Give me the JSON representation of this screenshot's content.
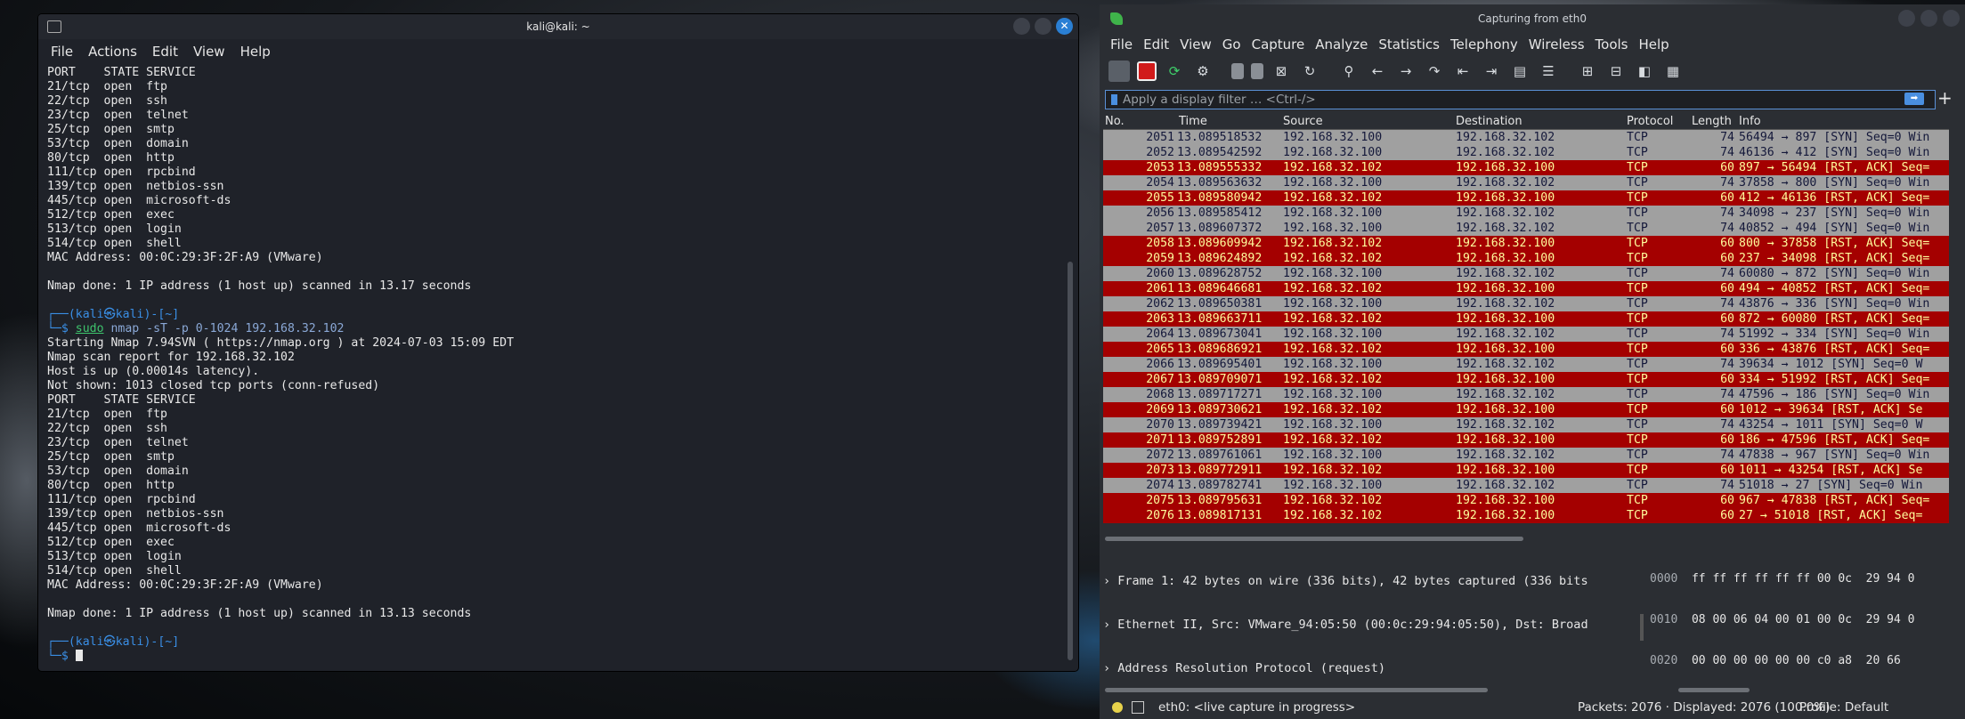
{
  "terminal": {
    "title": "kali@kali: ~",
    "menu": [
      "File",
      "Actions",
      "Edit",
      "View",
      "Help"
    ],
    "lines": [
      {
        "t": "plain",
        "text": "PORT    STATE SERVICE"
      },
      {
        "t": "plain",
        "text": "21/tcp  open  ftp"
      },
      {
        "t": "plain",
        "text": "22/tcp  open  ssh"
      },
      {
        "t": "plain",
        "text": "23/tcp  open  telnet"
      },
      {
        "t": "plain",
        "text": "25/tcp  open  smtp"
      },
      {
        "t": "plain",
        "text": "53/tcp  open  domain"
      },
      {
        "t": "plain",
        "text": "80/tcp  open  http"
      },
      {
        "t": "plain",
        "text": "111/tcp open  rpcbind"
      },
      {
        "t": "plain",
        "text": "139/tcp open  netbios-ssn"
      },
      {
        "t": "plain",
        "text": "445/tcp open  microsoft-ds"
      },
      {
        "t": "plain",
        "text": "512/tcp open  exec"
      },
      {
        "t": "plain",
        "text": "513/tcp open  login"
      },
      {
        "t": "plain",
        "text": "514/tcp open  shell"
      },
      {
        "t": "plain",
        "text": "MAC Address: 00:0C:29:3F:2F:A9 (VMware)"
      },
      {
        "t": "plain",
        "text": ""
      },
      {
        "t": "plain",
        "text": "Nmap done: 1 IP address (1 host up) scanned in 13.17 seconds"
      },
      {
        "t": "plain",
        "text": ""
      },
      {
        "t": "prompt1",
        "text": "┌──(kali㉿kali)-[~]"
      },
      {
        "t": "cmd",
        "prefix": "└─$ ",
        "cmd": "sudo",
        "args": " nmap -sT -p 0-1024 192.168.32.102"
      },
      {
        "t": "plain",
        "text": "Starting Nmap 7.94SVN ( https://nmap.org ) at 2024-07-03 15:09 EDT"
      },
      {
        "t": "plain",
        "text": "Nmap scan report for 192.168.32.102"
      },
      {
        "t": "plain",
        "text": "Host is up (0.00014s latency)."
      },
      {
        "t": "plain",
        "text": "Not shown: 1013 closed tcp ports (conn-refused)"
      },
      {
        "t": "plain",
        "text": "PORT    STATE SERVICE"
      },
      {
        "t": "plain",
        "text": "21/tcp  open  ftp"
      },
      {
        "t": "plain",
        "text": "22/tcp  open  ssh"
      },
      {
        "t": "plain",
        "text": "23/tcp  open  telnet"
      },
      {
        "t": "plain",
        "text": "25/tcp  open  smtp"
      },
      {
        "t": "plain",
        "text": "53/tcp  open  domain"
      },
      {
        "t": "plain",
        "text": "80/tcp  open  http"
      },
      {
        "t": "plain",
        "text": "111/tcp open  rpcbind"
      },
      {
        "t": "plain",
        "text": "139/tcp open  netbios-ssn"
      },
      {
        "t": "plain",
        "text": "445/tcp open  microsoft-ds"
      },
      {
        "t": "plain",
        "text": "512/tcp open  exec"
      },
      {
        "t": "plain",
        "text": "513/tcp open  login"
      },
      {
        "t": "plain",
        "text": "514/tcp open  shell"
      },
      {
        "t": "plain",
        "text": "MAC Address: 00:0C:29:3F:2F:A9 (VMware)"
      },
      {
        "t": "plain",
        "text": ""
      },
      {
        "t": "plain",
        "text": "Nmap done: 1 IP address (1 host up) scanned in 13.13 seconds"
      },
      {
        "t": "plain",
        "text": ""
      },
      {
        "t": "prompt1",
        "text": "┌──(kali㉿kali)-[~]"
      },
      {
        "t": "cursor",
        "prefix": "└─$ "
      }
    ]
  },
  "wireshark": {
    "title": "Capturing from eth0",
    "menu": [
      "File",
      "Edit",
      "View",
      "Go",
      "Capture",
      "Analyze",
      "Statistics",
      "Telephony",
      "Wireless",
      "Tools",
      "Help"
    ],
    "filter_placeholder": "Apply a display filter … <Ctrl-/>",
    "columns": {
      "no": "No.",
      "time": "Time",
      "source": "Source",
      "destination": "Destination",
      "protocol": "Protocol",
      "length": "Length",
      "info": "Info"
    },
    "packets": [
      {
        "no": "2051",
        "time": "13.089518532",
        "src": "192.168.32.100",
        "dst": "192.168.32.102",
        "proto": "TCP",
        "len": "74",
        "info": "56494 → 897 [SYN] Seq=0 Win",
        "kind": "syn"
      },
      {
        "no": "2052",
        "time": "13.089542592",
        "src": "192.168.32.100",
        "dst": "192.168.32.102",
        "proto": "TCP",
        "len": "74",
        "info": "46136 → 412 [SYN] Seq=0 Win",
        "kind": "syn"
      },
      {
        "no": "2053",
        "time": "13.089555332",
        "src": "192.168.32.102",
        "dst": "192.168.32.100",
        "proto": "TCP",
        "len": "60",
        "info": "897 → 56494 [RST, ACK] Seq=",
        "kind": "rst"
      },
      {
        "no": "2054",
        "time": "13.089563632",
        "src": "192.168.32.100",
        "dst": "192.168.32.102",
        "proto": "TCP",
        "len": "74",
        "info": "37858 → 800 [SYN] Seq=0 Win",
        "kind": "syn"
      },
      {
        "no": "2055",
        "time": "13.089580942",
        "src": "192.168.32.102",
        "dst": "192.168.32.100",
        "proto": "TCP",
        "len": "60",
        "info": "412 → 46136 [RST, ACK] Seq=",
        "kind": "rst"
      },
      {
        "no": "2056",
        "time": "13.089585412",
        "src": "192.168.32.100",
        "dst": "192.168.32.102",
        "proto": "TCP",
        "len": "74",
        "info": "34098 → 237 [SYN] Seq=0 Win",
        "kind": "syn"
      },
      {
        "no": "2057",
        "time": "13.089607372",
        "src": "192.168.32.100",
        "dst": "192.168.32.102",
        "proto": "TCP",
        "len": "74",
        "info": "40852 → 494 [SYN] Seq=0 Win",
        "kind": "syn"
      },
      {
        "no": "2058",
        "time": "13.089609942",
        "src": "192.168.32.102",
        "dst": "192.168.32.100",
        "proto": "TCP",
        "len": "60",
        "info": "800 → 37858 [RST, ACK] Seq=",
        "kind": "rst"
      },
      {
        "no": "2059",
        "time": "13.089624892",
        "src": "192.168.32.102",
        "dst": "192.168.32.100",
        "proto": "TCP",
        "len": "60",
        "info": "237 → 34098 [RST, ACK] Seq=",
        "kind": "rst"
      },
      {
        "no": "2060",
        "time": "13.089628752",
        "src": "192.168.32.100",
        "dst": "192.168.32.102",
        "proto": "TCP",
        "len": "74",
        "info": "60080 → 872 [SYN] Seq=0 Win",
        "kind": "syn"
      },
      {
        "no": "2061",
        "time": "13.089646681",
        "src": "192.168.32.102",
        "dst": "192.168.32.100",
        "proto": "TCP",
        "len": "60",
        "info": "494 → 40852 [RST, ACK] Seq=",
        "kind": "rst"
      },
      {
        "no": "2062",
        "time": "13.089650381",
        "src": "192.168.32.100",
        "dst": "192.168.32.102",
        "proto": "TCP",
        "len": "74",
        "info": "43876 → 336 [SYN] Seq=0 Win",
        "kind": "syn"
      },
      {
        "no": "2063",
        "time": "13.089663711",
        "src": "192.168.32.102",
        "dst": "192.168.32.100",
        "proto": "TCP",
        "len": "60",
        "info": "872 → 60080 [RST, ACK] Seq=",
        "kind": "rst"
      },
      {
        "no": "2064",
        "time": "13.089673041",
        "src": "192.168.32.100",
        "dst": "192.168.32.102",
        "proto": "TCP",
        "len": "74",
        "info": "51992 → 334 [SYN] Seq=0 Win",
        "kind": "syn"
      },
      {
        "no": "2065",
        "time": "13.089686921",
        "src": "192.168.32.102",
        "dst": "192.168.32.100",
        "proto": "TCP",
        "len": "60",
        "info": "336 → 43876 [RST, ACK] Seq=",
        "kind": "rst"
      },
      {
        "no": "2066",
        "time": "13.089695401",
        "src": "192.168.32.100",
        "dst": "192.168.32.102",
        "proto": "TCP",
        "len": "74",
        "info": "39634 → 1012 [SYN] Seq=0 W",
        "kind": "syn"
      },
      {
        "no": "2067",
        "time": "13.089709071",
        "src": "192.168.32.102",
        "dst": "192.168.32.100",
        "proto": "TCP",
        "len": "60",
        "info": "334 → 51992 [RST, ACK] Seq=",
        "kind": "rst"
      },
      {
        "no": "2068",
        "time": "13.089717271",
        "src": "192.168.32.100",
        "dst": "192.168.32.102",
        "proto": "TCP",
        "len": "74",
        "info": "47596 → 186 [SYN] Seq=0 Win",
        "kind": "syn"
      },
      {
        "no": "2069",
        "time": "13.089730621",
        "src": "192.168.32.102",
        "dst": "192.168.32.100",
        "proto": "TCP",
        "len": "60",
        "info": "1012 → 39634 [RST, ACK] Se",
        "kind": "rst"
      },
      {
        "no": "2070",
        "time": "13.089739421",
        "src": "192.168.32.100",
        "dst": "192.168.32.102",
        "proto": "TCP",
        "len": "74",
        "info": "43254 → 1011 [SYN] Seq=0 W",
        "kind": "syn"
      },
      {
        "no": "2071",
        "time": "13.089752891",
        "src": "192.168.32.102",
        "dst": "192.168.32.100",
        "proto": "TCP",
        "len": "60",
        "info": "186 → 47596 [RST, ACK] Seq=",
        "kind": "rst"
      },
      {
        "no": "2072",
        "time": "13.089761061",
        "src": "192.168.32.100",
        "dst": "192.168.32.102",
        "proto": "TCP",
        "len": "74",
        "info": "47838 → 967 [SYN] Seq=0 Win",
        "kind": "syn"
      },
      {
        "no": "2073",
        "time": "13.089772911",
        "src": "192.168.32.102",
        "dst": "192.168.32.100",
        "proto": "TCP",
        "len": "60",
        "info": "1011 → 43254 [RST, ACK] Se",
        "kind": "rst"
      },
      {
        "no": "2074",
        "time": "13.089782741",
        "src": "192.168.32.100",
        "dst": "192.168.32.102",
        "proto": "TCP",
        "len": "74",
        "info": "51018 → 27 [SYN] Seq=0 Win",
        "kind": "syn"
      },
      {
        "no": "2075",
        "time": "13.089795631",
        "src": "192.168.32.102",
        "dst": "192.168.32.100",
        "proto": "TCP",
        "len": "60",
        "info": "967 → 47838 [RST, ACK] Seq=",
        "kind": "rst"
      },
      {
        "no": "2076",
        "time": "13.089817131",
        "src": "192.168.32.102",
        "dst": "192.168.32.100",
        "proto": "TCP",
        "len": "60",
        "info": "27 → 51018 [RST, ACK] Seq=",
        "kind": "rst"
      }
    ],
    "details": [
      "Frame 1: 42 bytes on wire (336 bits), 42 bytes captured (336 bits",
      "Ethernet II, Src: VMware_94:05:50 (00:0c:29:94:05:50), Dst: Broad",
      "Address Resolution Protocol (request)"
    ],
    "bytes": [
      {
        "off": "0000",
        "hex": "ff ff ff ff ff ff 00 0c  29 94 0"
      },
      {
        "off": "0010",
        "hex": "08 00 06 04 00 01 00 0c  29 94 0"
      },
      {
        "off": "0020",
        "hex": "00 00 00 00 00 00 c0 a8  20 66"
      }
    ],
    "status": {
      "capture": "eth0: <live capture in progress>",
      "packets": "Packets: 2076 · Displayed: 2076 (100.0%)",
      "profile": "Profile: Default"
    },
    "colors": {
      "syn_bg": "#a0a0a0",
      "rst_bg": "#a40000",
      "rst_fg": "#fffc9c"
    }
  }
}
